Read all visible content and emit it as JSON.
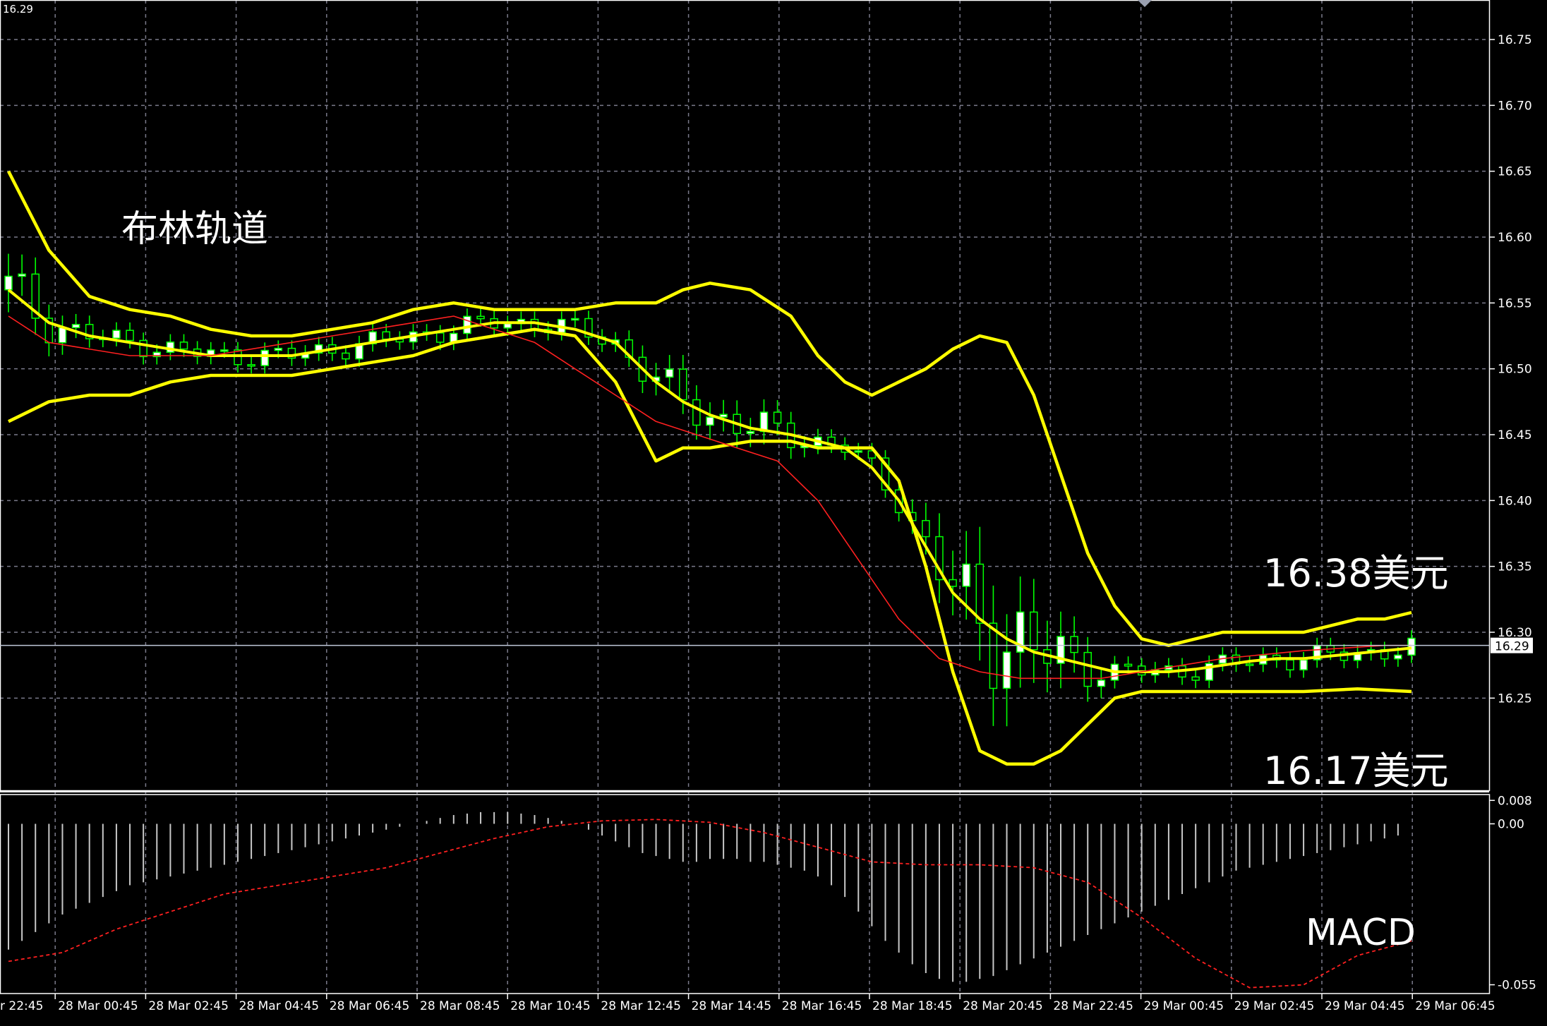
{
  "chart_data": [
    {
      "type": "candlestick",
      "corner_label": "16.29",
      "title": "布林轨道",
      "annotations": {
        "upper_band": "16.38美元",
        "lower_band": "16.17美元"
      },
      "current_price": 16.29,
      "ylim": [
        16.18,
        16.78
      ],
      "y_ticks": [
        "16.75",
        "16.70",
        "16.65",
        "16.60",
        "16.55",
        "16.50",
        "16.45",
        "16.40",
        "16.35",
        "16.30",
        "16.25"
      ],
      "x_ticks": [
        "28 Mar 00:45",
        "28 Mar 02:45",
        "28 Mar 04:45",
        "28 Mar 06:45",
        "28 Mar 08:45",
        "28 Mar 10:45",
        "28 Mar 12:45",
        "28 Mar 14:45",
        "28 Mar 16:45",
        "28 Mar 18:45",
        "28 Mar 20:45",
        "28 Mar 22:45",
        "29 Mar 00:45",
        "29 Mar 02:45",
        "29 Mar 04:45",
        "29 Mar 06:45"
      ],
      "x_first_tick_partial": "r 22:45",
      "bollinger": {
        "upper_x": [
          0,
          3,
          6,
          9,
          12,
          15,
          18,
          21,
          24,
          27,
          30,
          33,
          36,
          39,
          42,
          45,
          48,
          50,
          52,
          55,
          58,
          60,
          62,
          64,
          66,
          68,
          70,
          72,
          74,
          76,
          78,
          80,
          82,
          84,
          86,
          88,
          90,
          92,
          94,
          96,
          98,
          100,
          102,
          104
        ],
        "upper": [
          16.65,
          16.59,
          16.555,
          16.545,
          16.54,
          16.53,
          16.525,
          16.525,
          16.53,
          16.535,
          16.545,
          16.55,
          16.545,
          16.545,
          16.545,
          16.55,
          16.55,
          16.56,
          16.565,
          16.56,
          16.54,
          16.51,
          16.49,
          16.48,
          16.49,
          16.5,
          16.515,
          16.525,
          16.52,
          16.48,
          16.42,
          16.36,
          16.32,
          16.295,
          16.29,
          16.295,
          16.3,
          16.3,
          16.3,
          16.3,
          16.305,
          16.31,
          16.31,
          16.315
        ],
        "middle": [
          16.56,
          16.535,
          16.525,
          16.52,
          16.515,
          16.51,
          16.51,
          16.51,
          16.515,
          16.52,
          16.525,
          16.53,
          16.535,
          16.535,
          16.53,
          16.52,
          16.49,
          16.475,
          16.465,
          16.455,
          16.45,
          16.445,
          16.44,
          16.425,
          16.4,
          16.365,
          16.33,
          16.31,
          16.295,
          16.285,
          16.28,
          16.275,
          16.27,
          16.27,
          16.27,
          16.272,
          16.275,
          16.278,
          16.28,
          16.28,
          16.282,
          16.284,
          16.286,
          16.288
        ],
        "lower": [
          16.46,
          16.475,
          16.48,
          16.48,
          16.49,
          16.495,
          16.495,
          16.495,
          16.5,
          16.505,
          16.51,
          16.52,
          16.525,
          16.53,
          16.525,
          16.49,
          16.43,
          16.44,
          16.44,
          16.445,
          16.445,
          16.44,
          16.44,
          16.44,
          16.415,
          16.35,
          16.27,
          16.21,
          16.2,
          16.2,
          16.21,
          16.23,
          16.25,
          16.255,
          16.255,
          16.255,
          16.255,
          16.255,
          16.255,
          16.255,
          16.256,
          16.257,
          16.256,
          16.255
        ]
      },
      "moving_average_x": [
        0,
        3,
        6,
        9,
        12,
        15,
        18,
        21,
        24,
        27,
        30,
        33,
        36,
        39,
        42,
        45,
        48,
        51,
        54,
        57,
        60,
        63,
        66,
        69,
        72,
        75,
        78,
        81,
        84,
        87,
        90,
        93,
        96,
        99,
        102,
        104
      ],
      "moving_average": [
        16.54,
        16.52,
        16.515,
        16.51,
        16.51,
        16.51,
        16.515,
        16.52,
        16.525,
        16.53,
        16.535,
        16.54,
        16.53,
        16.52,
        16.5,
        16.48,
        16.46,
        16.45,
        16.44,
        16.43,
        16.4,
        16.355,
        16.31,
        16.28,
        16.27,
        16.265,
        16.265,
        16.265,
        16.27,
        16.275,
        16.28,
        16.283,
        16.286,
        16.288,
        16.29,
        16.29
      ],
      "macd": {
        "ylim": [
          -0.058,
          0.01
        ],
        "y_ticks": [
          "0.008",
          "0.00",
          "-0.055"
        ],
        "histogram": [
          -0.043,
          -0.04,
          -0.037,
          -0.034,
          -0.031,
          -0.029,
          -0.027,
          -0.025,
          -0.023,
          -0.021,
          -0.02,
          -0.019,
          -0.018,
          -0.017,
          -0.016,
          -0.015,
          -0.014,
          -0.013,
          -0.012,
          -0.011,
          -0.01,
          -0.009,
          -0.008,
          -0.007,
          -0.006,
          -0.005,
          -0.004,
          -0.003,
          -0.002,
          -0.001,
          0.0,
          0.001,
          0.002,
          0.003,
          0.0035,
          0.004,
          0.004,
          0.004,
          0.0035,
          0.003,
          0.002,
          0.001,
          0.0,
          -0.002,
          -0.004,
          -0.006,
          -0.008,
          -0.01,
          -0.011,
          -0.012,
          -0.013,
          -0.013,
          -0.012,
          -0.012,
          -0.012,
          -0.013,
          -0.013,
          -0.014,
          -0.015,
          -0.016,
          -0.018,
          -0.021,
          -0.025,
          -0.03,
          -0.035,
          -0.04,
          -0.044,
          -0.048,
          -0.051,
          -0.053,
          -0.054,
          -0.054,
          -0.053,
          -0.052,
          -0.05,
          -0.048,
          -0.046,
          -0.044,
          -0.042,
          -0.04,
          -0.038,
          -0.036,
          -0.034,
          -0.032,
          -0.03,
          -0.028,
          -0.026,
          -0.024,
          -0.022,
          -0.02,
          -0.018,
          -0.016,
          -0.015,
          -0.014,
          -0.013,
          -0.012,
          -0.011,
          -0.01,
          -0.009,
          -0.008,
          -0.007,
          -0.006,
          -0.005,
          -0.004
        ],
        "signal_x": [
          0,
          4,
          8,
          12,
          16,
          20,
          24,
          28,
          32,
          36,
          40,
          44,
          48,
          52,
          56,
          60,
          64,
          68,
          72,
          76,
          80,
          84,
          88,
          92,
          96,
          100,
          104
        ],
        "signal": [
          -0.047,
          -0.044,
          -0.036,
          -0.03,
          -0.024,
          -0.021,
          -0.018,
          -0.015,
          -0.01,
          -0.005,
          -0.001,
          0.001,
          0.0015,
          0.0005,
          -0.003,
          -0.008,
          -0.013,
          -0.014,
          -0.014,
          -0.015,
          -0.02,
          -0.032,
          -0.046,
          -0.056,
          -0.055,
          -0.045,
          -0.04
        ]
      },
      "colors": {
        "background": "#000000",
        "grid": "#7a7a8a",
        "band": "#ffff00",
        "moving_average": "#ff2020",
        "candle_up": "#ffffff",
        "candle_down": "#000000",
        "candle_outline": "#00ff00",
        "macd_histogram": "#c8c8c8",
        "macd_signal": "#ff2020",
        "axis_text": "#ffffff"
      }
    }
  ]
}
